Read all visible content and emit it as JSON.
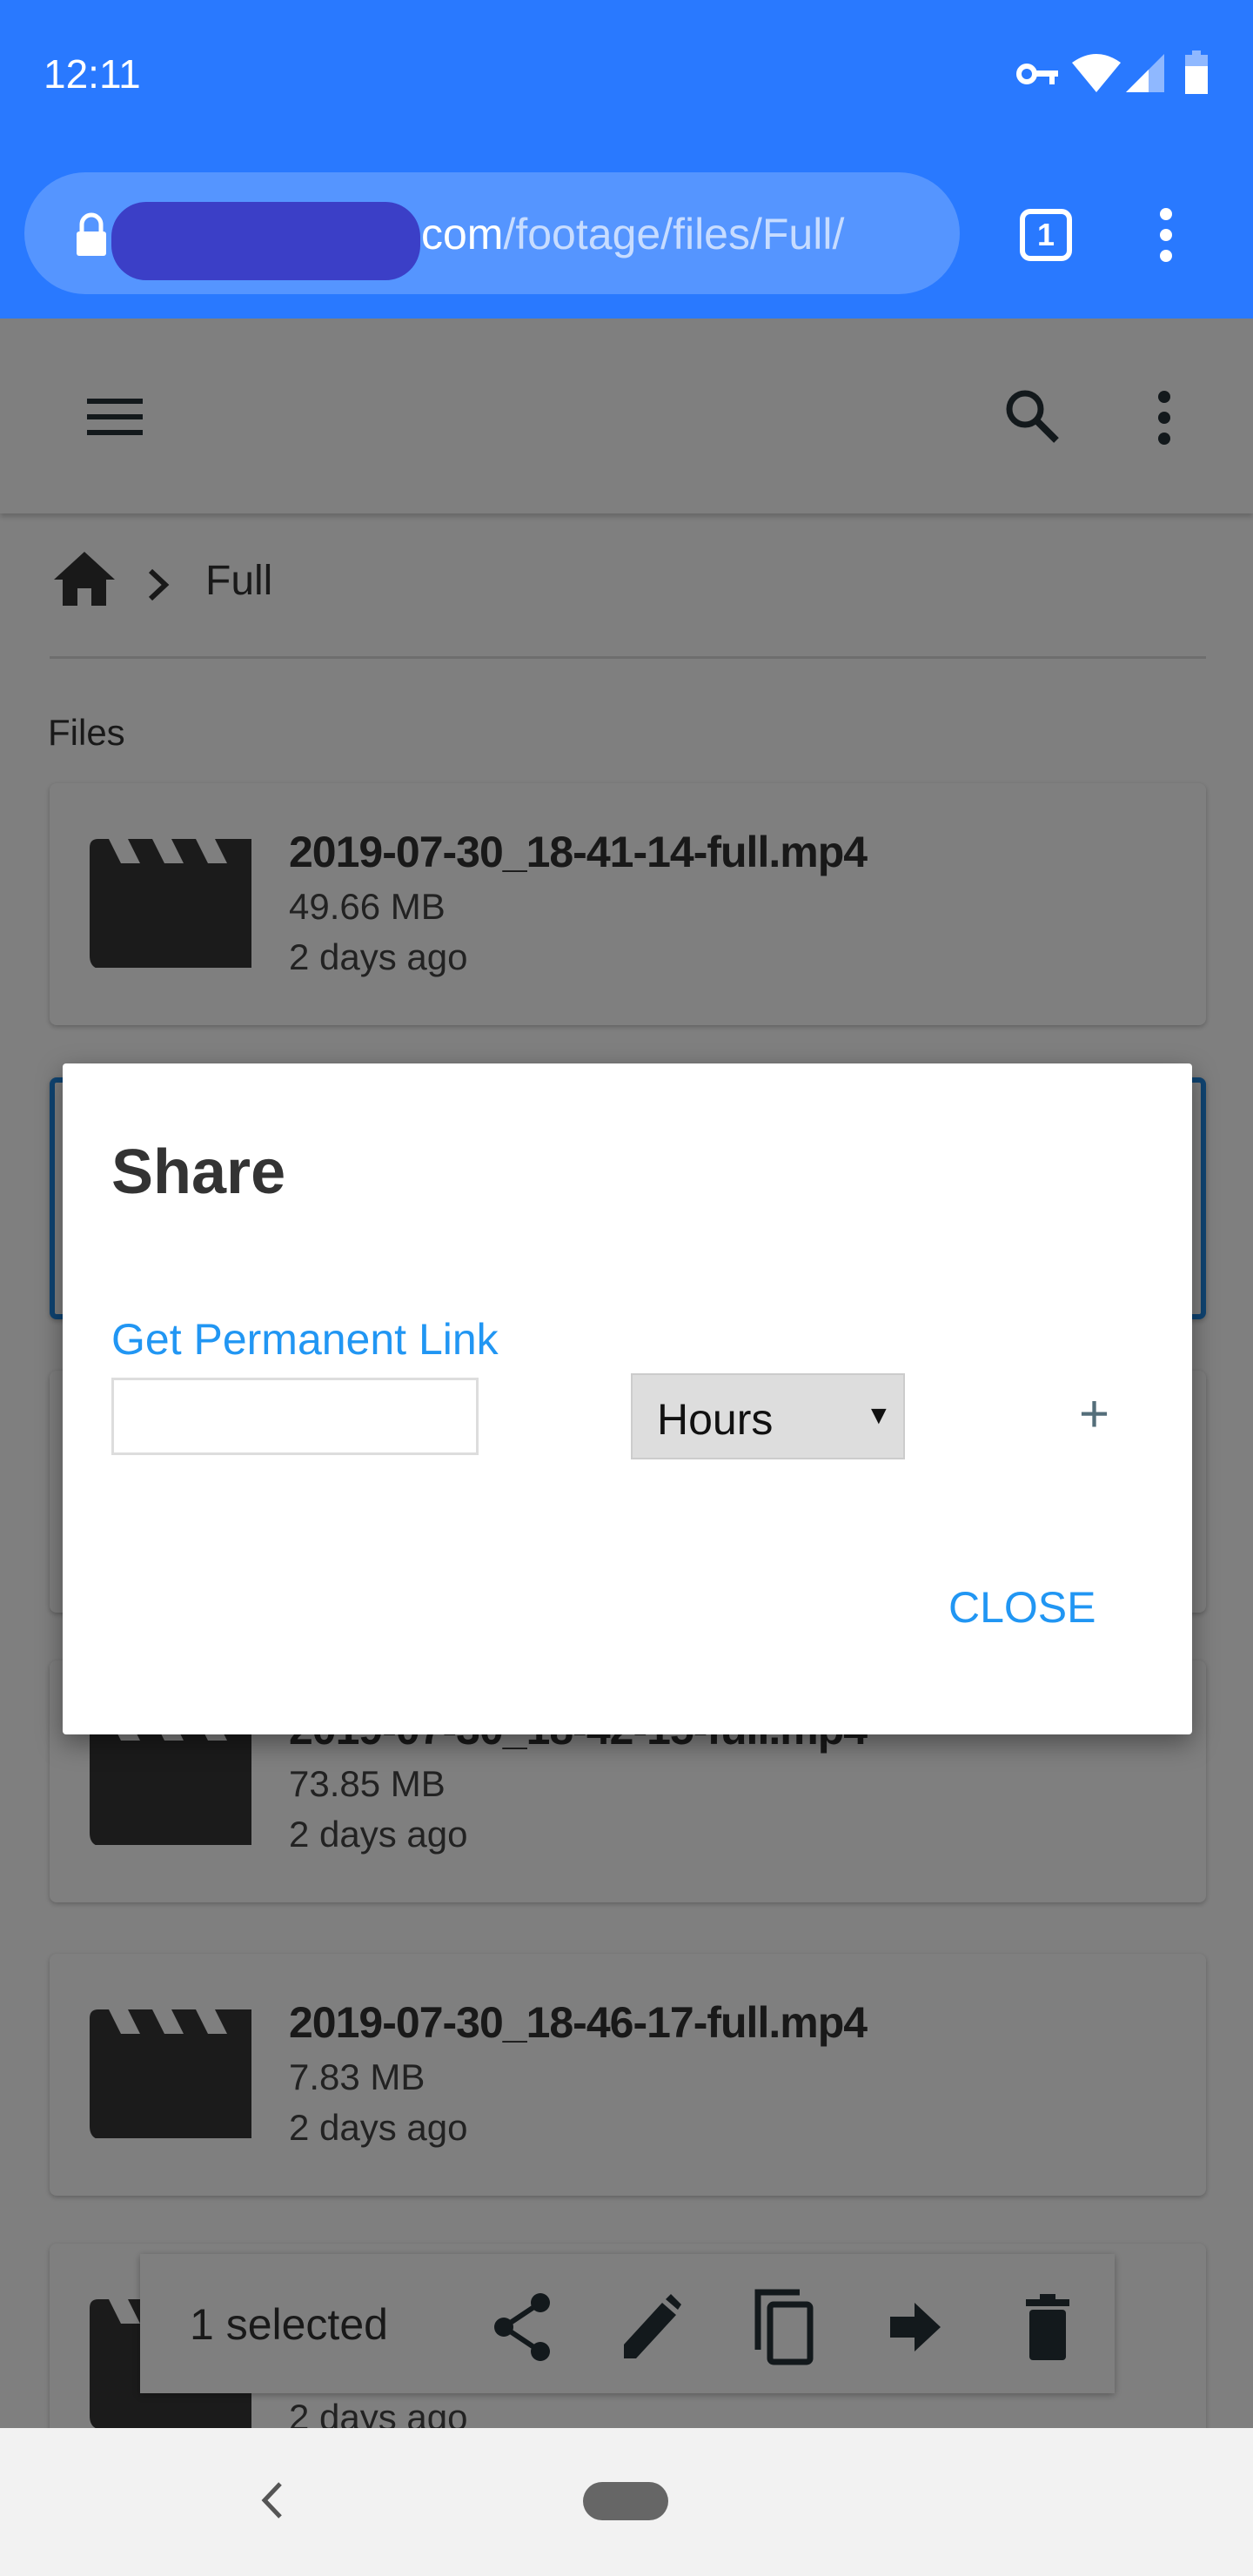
{
  "status_bar": {
    "time": "12:11",
    "icons": [
      "vpn-key-icon",
      "wifi-icon",
      "signal-icon",
      "battery-icon"
    ]
  },
  "browser": {
    "url_host_visible": "com",
    "url_path": "/footage/files/Full/",
    "tab_count": "1"
  },
  "breadcrumb": {
    "current": "Full"
  },
  "section_label": "Files",
  "files": [
    {
      "name": "2019-07-30_18-41-14-full.mp4",
      "size": "49.66 MB",
      "date": "2 days ago"
    },
    {
      "name": "",
      "size": "",
      "date": "",
      "selected": true
    },
    {
      "name": "",
      "size": "",
      "date": ""
    },
    {
      "name": "2019-07-30_18-42-15-full.mp4",
      "size": "73.85 MB",
      "date": "2 days ago"
    },
    {
      "name": "2019-07-30_18-46-17-full.mp4",
      "size": "7.83 MB",
      "date": "2 days ago"
    },
    {
      "name": "",
      "size": "",
      "date": "2 days ago"
    }
  ],
  "selection_bar": {
    "label": "1 selected",
    "actions": [
      "share-icon",
      "edit-icon",
      "copy-icon",
      "move-icon",
      "delete-icon"
    ]
  },
  "dialog": {
    "title": "Share",
    "permanent_link": "Get Permanent Link",
    "time_value": "",
    "unit_selected": "Hours",
    "add_label": "+",
    "close_label": "CLOSE"
  },
  "colors": {
    "chrome": "#2979ff",
    "link": "#2196f3",
    "selected": "#1e88e5"
  }
}
